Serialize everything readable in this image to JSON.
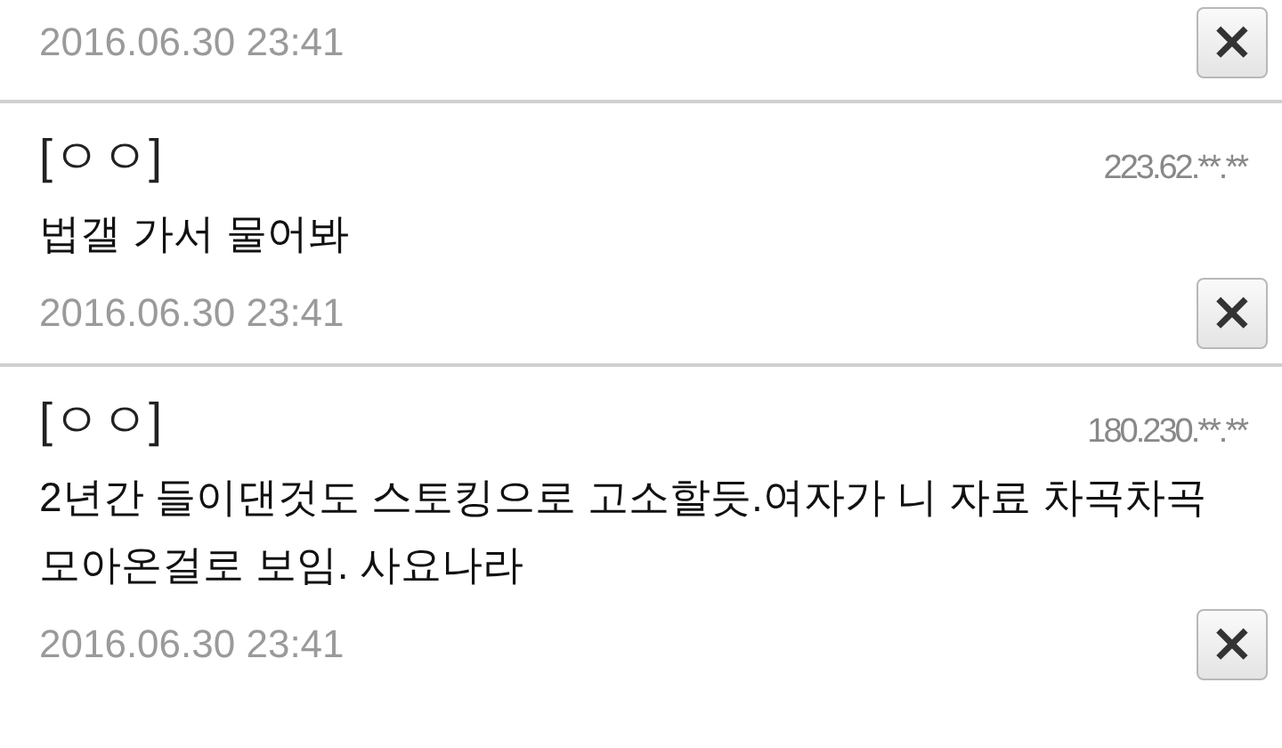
{
  "comments": [
    {
      "date": "2016.06.30 23:41",
      "delete": "×"
    },
    {
      "name": "[ㅇㅇ]",
      "ip": "223.62.**.**",
      "text": "법갤 가서 물어봐",
      "date": "2016.06.30 23:41",
      "delete": "×"
    },
    {
      "name": "[ㅇㅇ]",
      "ip": "180.230.**.**",
      "text": "2년간 들이댄것도 스토킹으로 고소할듯.여자가 니 자료 차곡차곡 모아온걸로 보임. 사요나라",
      "date": "2016.06.30 23:41",
      "delete": "×"
    }
  ]
}
